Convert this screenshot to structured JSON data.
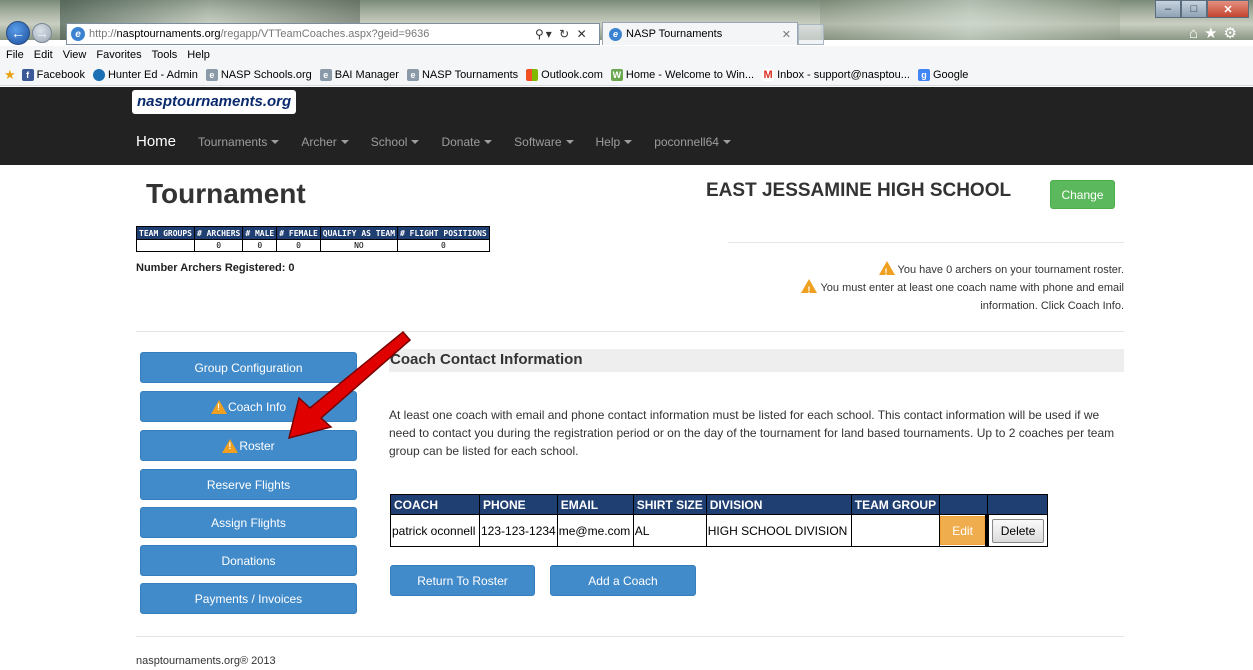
{
  "browser": {
    "url_prefix": "http://",
    "url_host": "nasptournaments.org",
    "url_path": "/regapp/VTTeamCoaches.aspx?geid=9636",
    "tab_title": "NASP Tournaments",
    "menu": [
      "File",
      "Edit",
      "View",
      "Favorites",
      "Tools",
      "Help"
    ],
    "favorites": [
      {
        "label": "Facebook",
        "icon": "facebook-icon",
        "color": "#3b5998"
      },
      {
        "label": "Hunter Ed - Admin",
        "icon": "globe-icon",
        "color": "#1a6fb5"
      },
      {
        "label": "NASP Schools.org",
        "icon": "ie-page-icon",
        "color": "#8a9aa8"
      },
      {
        "label": "BAI Manager",
        "icon": "ie-page-icon",
        "color": "#8a9aa8"
      },
      {
        "label": "NASP Tournaments",
        "icon": "ie-page-icon",
        "color": "#8a9aa8"
      },
      {
        "label": "Outlook.com",
        "icon": "windows-icon",
        "color": "#f25022"
      },
      {
        "label": "Home - Welcome to Win...",
        "icon": "w-icon",
        "color": "#6aa84f"
      },
      {
        "label": "Inbox - support@nasptou...",
        "icon": "gmail-icon",
        "color": "#d93025"
      },
      {
        "label": "Google",
        "icon": "google-icon",
        "color": "#4285f4"
      }
    ]
  },
  "site": {
    "logo": "nasptournaments.org",
    "nav": [
      {
        "label": "Home",
        "caret": false
      },
      {
        "label": "Tournaments",
        "caret": true
      },
      {
        "label": "Archer",
        "caret": true
      },
      {
        "label": "School",
        "caret": true
      },
      {
        "label": "Donate",
        "caret": true
      },
      {
        "label": "Software",
        "caret": true
      },
      {
        "label": "Help",
        "caret": true
      },
      {
        "label": "poconnell64",
        "caret": true
      }
    ]
  },
  "page": {
    "title": "Tournament",
    "school_name": "EAST JESSAMINE HIGH SCHOOL",
    "change_label": "Change",
    "stats": {
      "headers": [
        "TEAM GROUPS",
        "# ARCHERS",
        "# MALE",
        "# FEMALE",
        "QUALIFY AS TEAM",
        "# FLIGHT POSITIONS"
      ],
      "values": [
        "",
        "0",
        "0",
        "0",
        "NO",
        "0"
      ]
    },
    "archers_registered": "Number Archers Registered: 0",
    "warnings": {
      "roster": "You have 0 archers on your tournament roster.",
      "coach_line1": "You must enter at least one coach name with phone and email",
      "coach_line2": "information. Click Coach Info."
    }
  },
  "sidebar": {
    "items": [
      {
        "label": "Group Configuration",
        "warning": false
      },
      {
        "label": "Coach Info",
        "warning": true
      },
      {
        "label": "Roster",
        "warning": true
      },
      {
        "label": "Reserve Flights",
        "warning": false
      },
      {
        "label": "Assign Flights",
        "warning": false
      },
      {
        "label": "Donations",
        "warning": false
      },
      {
        "label": "Payments / Invoices",
        "warning": false
      }
    ]
  },
  "coach_section": {
    "heading": "Coach Contact Information",
    "intro": "At least one coach with email and phone contact information must be listed for each school. This contact information will be used if we need to contact you during the registration period or on the day of the tournament for land based tournaments. Up to 2 coaches per team group can be listed for each school.",
    "table": {
      "headers": [
        "COACH",
        "PHONE",
        "EMAIL",
        "SHIRT SIZE",
        "DIVISION",
        "TEAM GROUP",
        "",
        ""
      ],
      "rows": [
        {
          "coach": "patrick oconnell",
          "phone": "123-123-1234",
          "email": "me@me.com",
          "shirt_size": "AL",
          "division": "HIGH SCHOOL DIVISION",
          "team_group": "",
          "edit": "Edit",
          "delete": "Delete"
        }
      ]
    },
    "return_label": "Return To Roster",
    "add_label": "Add a Coach"
  },
  "footer": "nasptournaments.org® 2013",
  "colors": {
    "primary": "#428bca",
    "success": "#5cb85c",
    "warning": "#f0ad4e",
    "table_header": "#1f3e72",
    "navbar": "#222222",
    "annotation_arrow": "#e00000"
  }
}
